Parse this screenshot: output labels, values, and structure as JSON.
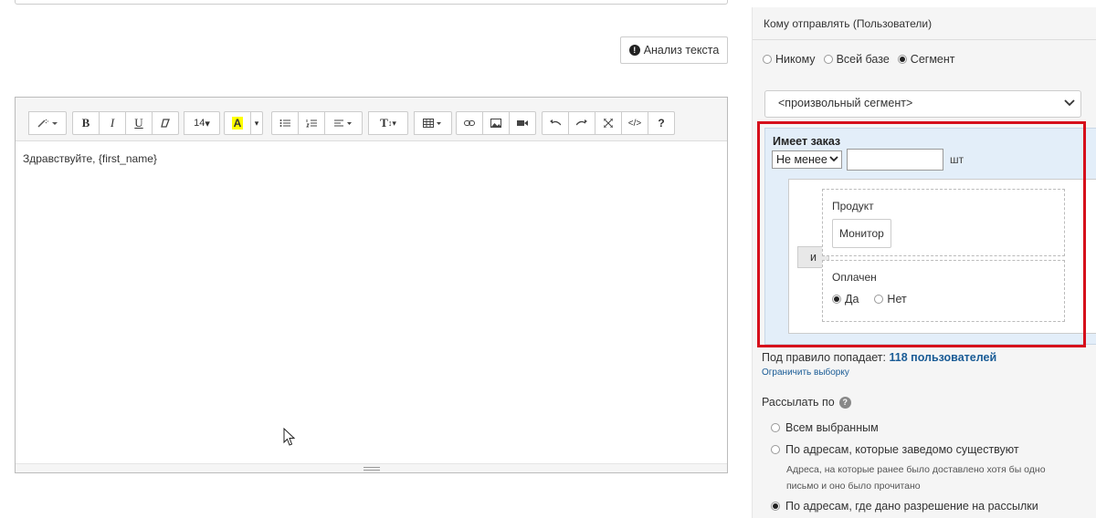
{
  "analyze_button": {
    "label": "Анализ текста",
    "icon": "exclamation-circle-icon"
  },
  "editor": {
    "toolbar": {
      "font_size": "14",
      "highlight_letter": "A",
      "text_style": "T",
      "help": "?"
    },
    "content": "Здравствуйте, {first_name}"
  },
  "panel": {
    "header": "Кому отправлять (Пользователи)",
    "recipients": [
      {
        "label": "Никому",
        "selected": false
      },
      {
        "label": "Всей базе",
        "selected": false
      },
      {
        "label": "Сегмент",
        "selected": true
      }
    ],
    "segment_select": "<произвольный сегмент>",
    "rule": {
      "title": "Имеет заказ",
      "operator": "Не менее",
      "quantity": "",
      "unit": "шт",
      "and_label": "и",
      "product_label": "Продукт",
      "product_value": "Монитор",
      "paid_label": "Оплачен",
      "paid_options": [
        {
          "label": "Да",
          "selected": true
        },
        {
          "label": "Нет",
          "selected": false
        }
      ]
    },
    "match_prefix": "Под правило попадает:",
    "match_count": "118 пользователей",
    "limit_link": "Ограничить выборку",
    "send_by_label": "Рассылать по",
    "send_options": [
      {
        "label": "Всем выбранным",
        "selected": false
      },
      {
        "label": "По адресам, которые заведомо существуют",
        "selected": false
      },
      {
        "label": "По адресам, где дано разрешение на рассылки",
        "selected": true
      }
    ],
    "send_note": "Адреса, на которые ранее было доставлено хотя бы одно письмо и оно было прочитано"
  },
  "colors": {
    "highlight_frame": "#d60f1b",
    "rule_background": "#e3eef9",
    "link": "#1a5c96"
  }
}
